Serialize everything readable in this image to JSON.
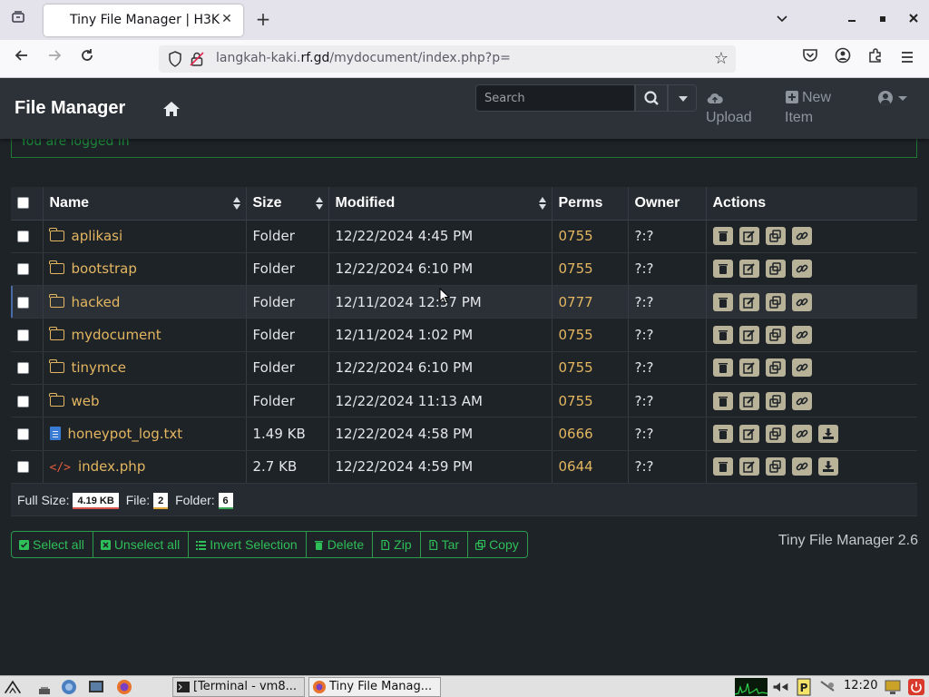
{
  "browser": {
    "tab_title": "Tiny File Manager | H3K",
    "url_domain_prefix": "langkah-kaki.",
    "url_domain": "rf.gd",
    "url_path": "/mydocument/index.php?p="
  },
  "app": {
    "brand": "File Manager",
    "search_placeholder": "Search",
    "upload_label": "Upload",
    "new_item_label_1": "New",
    "new_item_label_2": "Item",
    "alert_text": "You are logged in"
  },
  "table": {
    "headers": {
      "name": "Name",
      "size": "Size",
      "modified": "Modified",
      "perms": "Perms",
      "owner": "Owner",
      "actions": "Actions"
    },
    "rows": [
      {
        "type": "folder",
        "name": "aplikasi",
        "size": "Folder",
        "modified": "12/22/2024 4:45 PM",
        "perms": "0755",
        "owner": "?:?",
        "download": false
      },
      {
        "type": "folder",
        "name": "bootstrap",
        "size": "Folder",
        "modified": "12/22/2024 6:10 PM",
        "perms": "0755",
        "owner": "?:?",
        "download": false
      },
      {
        "type": "folder",
        "name": "hacked",
        "size": "Folder",
        "modified": "12/11/2024 12:57 PM",
        "perms": "0777",
        "owner": "?:?",
        "download": false
      },
      {
        "type": "folder",
        "name": "mydocument",
        "size": "Folder",
        "modified": "12/11/2024 1:02 PM",
        "perms": "0755",
        "owner": "?:?",
        "download": false
      },
      {
        "type": "folder",
        "name": "tinymce",
        "size": "Folder",
        "modified": "12/22/2024 6:10 PM",
        "perms": "0755",
        "owner": "?:?",
        "download": false
      },
      {
        "type": "folder",
        "name": "web",
        "size": "Folder",
        "modified": "12/22/2024 11:13 AM",
        "perms": "0755",
        "owner": "?:?",
        "download": false
      },
      {
        "type": "text",
        "name": "honeypot_log.txt",
        "size": "1.49 KB",
        "modified": "12/22/2024 4:58 PM",
        "perms": "0666",
        "owner": "?:?",
        "download": true
      },
      {
        "type": "code",
        "name": "index.php",
        "size": "2.7 KB",
        "modified": "12/22/2024 4:59 PM",
        "perms": "0644",
        "owner": "?:?",
        "download": true
      }
    ],
    "footer": {
      "full_size_label": "Full Size:",
      "full_size_value": "4.19 KB",
      "file_label": "File:",
      "file_value": "2",
      "folder_label": "Folder:",
      "folder_value": "6"
    }
  },
  "bulk_actions": {
    "select_all": "Select all",
    "unselect_all": "Unselect all",
    "invert_selection": "Invert Selection",
    "delete": "Delete",
    "zip": "Zip",
    "tar": "Tar",
    "copy": "Copy"
  },
  "version": "Tiny File Manager 2.6",
  "taskbar": {
    "task_terminal": "[Terminal - vm8...",
    "task_browser": "Tiny File Manag...",
    "clock": "12:20"
  }
}
